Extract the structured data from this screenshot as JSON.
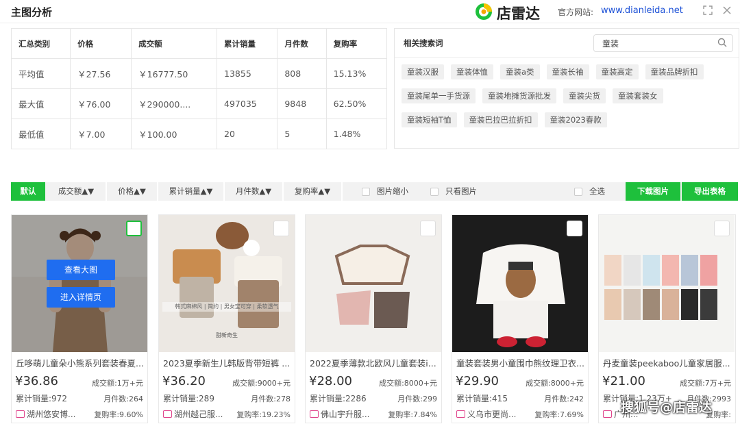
{
  "header": {
    "app_title": "主图分析",
    "brand_name": "店雷达",
    "site_label": "官方网站:",
    "site_url": "www.dianleida.net"
  },
  "stats": {
    "columns": [
      "汇总类别",
      "价格",
      "成交额",
      "累计销量",
      "月件数",
      "复购率"
    ],
    "rows": [
      [
        "平均值",
        "￥27.56",
        "￥16777.50",
        "13855",
        "808",
        "15.13%"
      ],
      [
        "最大值",
        "￥76.00",
        "￥290000....",
        "497035",
        "9848",
        "62.50%"
      ],
      [
        "最低值",
        "￥7.00",
        "￥100.00",
        "20",
        "5",
        "1.48%"
      ]
    ]
  },
  "keywords": {
    "title": "相关搜索词",
    "search_value": "童装",
    "tags": [
      "童装汉服",
      "童装体恤",
      "童装a类",
      "童装长袖",
      "童装高定",
      "童装品牌折扣",
      "童装尾单一手货源",
      "童装地摊货源批发",
      "童装尖货",
      "童装套装女",
      "童装短袖T恤",
      "童装巴拉巴拉折扣",
      "童装2023春款"
    ]
  },
  "toolbar": {
    "default_label": "默认",
    "sort_amount": "成交额▲▼",
    "sort_price": "价格▲▼",
    "sort_sales": "累计销量▲▼",
    "sort_monthly": "月件数▲▼",
    "sort_repurchase": "复购率▲▼",
    "shrink_label": "图片缩小",
    "only_image_label": "只看图片",
    "select_all_label": "全选",
    "download_label": "下载图片",
    "export_label": "导出表格"
  },
  "overlay": {
    "view_large": "查看大图",
    "view_detail": "进入详情页"
  },
  "products": [
    {
      "title": "丘哆萌儿童朵小熊系列套装春夏...",
      "price": "¥36.86",
      "amount": "成交额:1万+元",
      "sales": "累计销量:972",
      "monthly": "月件数:264",
      "shop": "湖州悠安博...",
      "repurchase": "复购率:9.60%"
    },
    {
      "title": "2023夏季新生儿韩版背带短裤 ...",
      "price": "¥36.20",
      "amount": "成交额:9000+元",
      "sales": "累计销量:289",
      "monthly": "月件数:278",
      "shop": "湖州越己服...",
      "repurchase": "复购率:19.23%"
    },
    {
      "title": "2022夏季薄款北欧风儿童套装i...",
      "price": "¥28.00",
      "amount": "成交额:8000+元",
      "sales": "累计销量:2286",
      "monthly": "月件数:299",
      "shop": "佛山宇升服...",
      "repurchase": "复购率:7.84%"
    },
    {
      "title": "童装套装男小童围巾熊纹理卫衣...",
      "price": "¥29.90",
      "amount": "成交额:8000+元",
      "sales": "累计销量:415",
      "monthly": "月件数:242",
      "shop": "义乌市更尚...",
      "repurchase": "复购率:7.69%"
    },
    {
      "title": "丹麦童装peekaboo儿童家居服...",
      "price": "¥21.00",
      "amount": "成交额:7万+元",
      "sales": "累计销量:1.23万+",
      "monthly": "月件数:2993",
      "shop": "广州...",
      "repurchase": "复购率:"
    }
  ],
  "image_captions": {
    "card2_banner": "韩式麻棉风 | 简约 | 男女宝可穿 | 柔软透气",
    "card2_brand": "甜新奇生"
  },
  "watermark": "搜狐号@店雷达",
  "colors": {
    "accent_green": "#1ec03c",
    "button_blue": "#1f6df0",
    "link_blue": "#1a4fd6"
  }
}
